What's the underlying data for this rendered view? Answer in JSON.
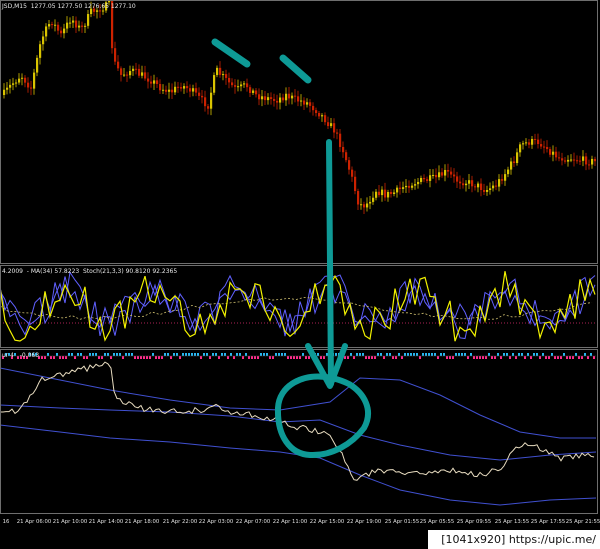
{
  "panes": {
    "price": {
      "header": "JSD,M15  1277.05 1277.50 1276.65 1277.10"
    },
    "stoch": {
      "header": "4.2009  - MA(34) 57.8223  Stoch(21,3,3) 90.8120 92.2365"
    },
    "osc": {
      "header": "ur 4   -0.063"
    }
  },
  "xaxis": {
    "labels": [
      "16",
      "21 Apr 06:00",
      "21 Apr 10:00",
      "21 Apr 14:00",
      "21 Apr 18:00",
      "21 Apr 22:00",
      "22 Apr 03:00",
      "22 Apr 07:00",
      "22 Apr 11:00",
      "22 Apr 15:00",
      "22 Apr 19:00",
      "25 Apr 01:55",
      "25 Apr 05:55",
      "25 Apr 09:55",
      "25 Apr 13:55",
      "25 Apr 17:55",
      "25 Apr 21:55"
    ]
  },
  "footer": {
    "text": "[1041x920] https://upic.me/"
  },
  "colors": {
    "bull": "#d9c400",
    "bear": "#cc2200",
    "annotation": "#0e9a96",
    "stoch_main": "#f2f200",
    "stoch_bands": "#6060ff",
    "ma": "#d0c070",
    "osc_line": "#e8dcc0",
    "osc_bands": "#4050d0",
    "histo_pos": "#27b6f0",
    "histo_neg": "#ff2a8a"
  },
  "icons": [
    "annotation-dash-left",
    "annotation-dash-right",
    "annotation-arrow",
    "annotation-circle"
  ]
}
